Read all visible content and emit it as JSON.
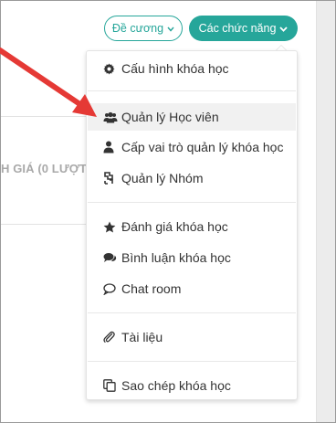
{
  "header": {
    "outline_button": {
      "label": "Đề cương",
      "icon": "chevron-down-icon"
    },
    "functions_button": {
      "label": "Các chức năng",
      "icon": "chevron-down-icon",
      "color": "#26a69a"
    }
  },
  "background": {
    "partial_label": "H GIÁ (0 LƯỢT"
  },
  "menu": {
    "items": [
      {
        "label": "Cấu hình khóa học",
        "icon": "gear-icon"
      },
      {
        "label": "Quản lý Học viên",
        "icon": "users-icon",
        "highlighted": true
      },
      {
        "label": "Cấp vai trò quản lý khóa học",
        "icon": "user-icon"
      },
      {
        "label": "Quản lý Nhóm",
        "icon": "group-swap-icon"
      },
      {
        "label": "Đánh giá khóa học",
        "icon": "star-icon"
      },
      {
        "label": "Bình luận khóa học",
        "icon": "comments-icon"
      },
      {
        "label": "Chat room",
        "icon": "chat-bubble-icon"
      },
      {
        "label": "Tài liệu",
        "icon": "paperclip-icon"
      },
      {
        "label": "Sao chép khóa học",
        "icon": "copy-icon"
      }
    ]
  },
  "annotation": {
    "color": "#e53935",
    "icon": "arrow-icon"
  }
}
